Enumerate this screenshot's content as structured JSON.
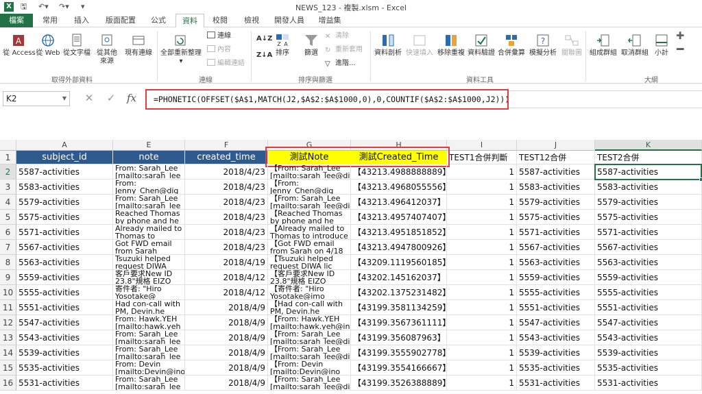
{
  "window": {
    "title": "NEWS_123 - 複製.xlsm - Excel"
  },
  "tabs": [
    "檔案",
    "常用",
    "插入",
    "版面配置",
    "公式",
    "資料",
    "校閱",
    "檢視",
    "開發人員",
    "增益集"
  ],
  "ribbon": {
    "external": {
      "access": "從 Access",
      "web": "從 Web",
      "text": "從文字檔",
      "other_line1": "從其他",
      "other_line2": "來源",
      "existing": "現有連線",
      "group": "取得外部資料"
    },
    "connections": {
      "refresh_all": "全部重新整理",
      "conn": "連線",
      "props": "內容",
      "edit_links": "編輯連結",
      "group": "連線"
    },
    "sort_filter": {
      "sort": "排序",
      "filter": "篩選",
      "clear": "清除",
      "reapply": "重新套用",
      "advanced": "進階...",
      "group": "排序與篩選"
    },
    "data_tools": {
      "text_to_cols": "資料剖析",
      "flash_fill": "快速填入",
      "remove_dup": "移除重複",
      "validation": "資料驗證",
      "consolidate": "合併彙算",
      "whatif": "模擬分析",
      "relationships": "關聯圖",
      "group": "資料工具"
    },
    "outline": {
      "group_btn": "組成群組",
      "ungroup": "取消群組",
      "subtotal": "小計",
      "group": "大綱"
    }
  },
  "formula_bar": {
    "name_box": "K2",
    "formula": "=PHONETIC(OFFSET($A$1,MATCH(J2,$A$2:$A$1000,0),0,COUNTIF($A$2:$A$1000,J2)))"
  },
  "columns": [
    "A",
    "E",
    "F",
    "G",
    "H",
    "I",
    "J",
    "K"
  ],
  "header_row": {
    "A": "subject_id",
    "E": "note",
    "F": "created_time",
    "G": "測試Note",
    "H": "測試Created_Time",
    "I": "TEST1合併判斷",
    "J": "TEST12合併",
    "K": "TEST2合併"
  },
  "rows": [
    {
      "n": "2",
      "A": "5587-activities",
      "E": "From: Sarah_Lee [mailto:sarah_lee",
      "F": "2018/4/23",
      "G": "【From: Sarah_Lee [mailto:sarah_lee@di",
      "H": "【43213.4988888889】",
      "I": "1",
      "J": "5587-activities",
      "K": "5587-activities"
    },
    {
      "n": "3",
      "A": "5583-activities",
      "E": "From: Jenny_Chen@dig",
      "F": "2018/4/23",
      "G": "【From: Jenny_Chen@dig",
      "H": "【43213.4968055556】",
      "I": "1",
      "J": "5583-activities",
      "K": "5583-activities"
    },
    {
      "n": "4",
      "A": "5579-activities",
      "E": "From: Sarah_Lee [mailto:sarah_lee",
      "F": "2018/4/23",
      "G": "【From: Sarah_Lee [mailto:sarah_lee@di",
      "H": "【43213.496412037】",
      "I": "1",
      "J": "5579-activities",
      "K": "5579-activities"
    },
    {
      "n": "5",
      "A": "5575-activities",
      "E": "Reached Thomas by phone and he",
      "F": "2018/4/23",
      "G": "【Reached Thomas by phone and he",
      "H": "【43213.4957407407】",
      "I": "1",
      "J": "5575-activities",
      "K": "5575-activities"
    },
    {
      "n": "6",
      "A": "5571-activities",
      "E": "Already mailed to Thomas to",
      "F": "2018/4/23",
      "G": "【Already mailed to Thomas to introduce",
      "H": "【43213.4951851852】",
      "I": "1",
      "J": "5571-activities",
      "K": "5571-activities"
    },
    {
      "n": "7",
      "A": "5567-activities",
      "E": "Got FWD email from Sarah",
      "F": "2018/4/23",
      "G": "【Got FWD email from Sarah on 4/18",
      "H": "【43213.4947800926】",
      "I": "1",
      "J": "5567-activities",
      "K": "5567-activities"
    },
    {
      "n": "8",
      "A": "5563-activities",
      "E": "Tsuzuki helped request DIWA",
      "F": "2018/4/19",
      "G": "【Tsuzuki helped request DIWA lic",
      "H": "【43209.1119560185】",
      "I": "1",
      "J": "5563-activities",
      "K": "5563-activities"
    },
    {
      "n": "9",
      "A": "5559-activities",
      "E": "客戶要求New ID 23.8\"規格 EIZO",
      "F": "2018/4/12",
      "G": "【客戶要求New ID 23.8\"規格 EIZO",
      "H": "【43202.145162037】",
      "I": "1",
      "J": "5559-activities",
      "K": "5559-activities"
    },
    {
      "n": "10",
      "A": "5555-activities",
      "E": "寄件者: \"Hiro Yosotake@",
      "F": "2018/4/12",
      "G": "【寄件者: \"Hiro Yosotake@imo",
      "H": "【43202.1375231482】",
      "I": "1",
      "J": "5555-activities",
      "K": "5555-activities"
    },
    {
      "n": "11",
      "A": "5551-activities",
      "E": "Had con-call with PM, Devin.he",
      "F": "2018/4/9",
      "G": "【Had con-call with PM, Devin.he",
      "H": "【43199.3581134259】",
      "I": "1",
      "J": "5551-activities",
      "K": "5551-activities"
    },
    {
      "n": "12",
      "A": "5547-activities",
      "E": "From: Hawk.YEH [mailto:hawk.yeh",
      "F": "2018/4/9",
      "G": "【From: Hawk.YEH [mailto:hawk.yeh@in",
      "H": "【43199.3567361111】",
      "I": "1",
      "J": "5547-activities",
      "K": "5547-activities"
    },
    {
      "n": "13",
      "A": "5543-activities",
      "E": "From: Sarah_Lee [mailto:sarah_lee",
      "F": "2018/4/9",
      "G": "【From: Sarah_Lee [mailto:sarah_lee@di",
      "H": "【43199.356087963】",
      "I": "1",
      "J": "5543-activities",
      "K": "5543-activities"
    },
    {
      "n": "14",
      "A": "5539-activities",
      "E": "From: Sarah_Lee [mailto:sarah_lee",
      "F": "2018/4/9",
      "G": "【From: Sarah_Lee [mailto:sarah_lee@di",
      "H": "【43199.3555902778】",
      "I": "1",
      "J": "5539-activities",
      "K": "5539-activities"
    },
    {
      "n": "15",
      "A": "5535-activities",
      "E": "From: Devin [mailto:Devin@ino",
      "F": "2018/4/9",
      "G": "【From: Devin [mailto:Devin@ino",
      "H": "【43199.3554166667】",
      "I": "1",
      "J": "5535-activities",
      "K": "5535-activities"
    },
    {
      "n": "16",
      "A": "5531-activities",
      "E": "From: Sarah_Lee [mailto:sarah_lee",
      "F": "2018/4/9",
      "G": "【From: Sarah_Lee [mailto:sarah_lee@di",
      "H": "【43199.3526388889】",
      "I": "1",
      "J": "5531-activities",
      "K": "5531-activities"
    }
  ],
  "colors": {
    "excel_green": "#217346",
    "header_blue": "#2e5a8e",
    "highlight_yellow": "#ffff00",
    "annotation_red": "#e23c3c"
  }
}
